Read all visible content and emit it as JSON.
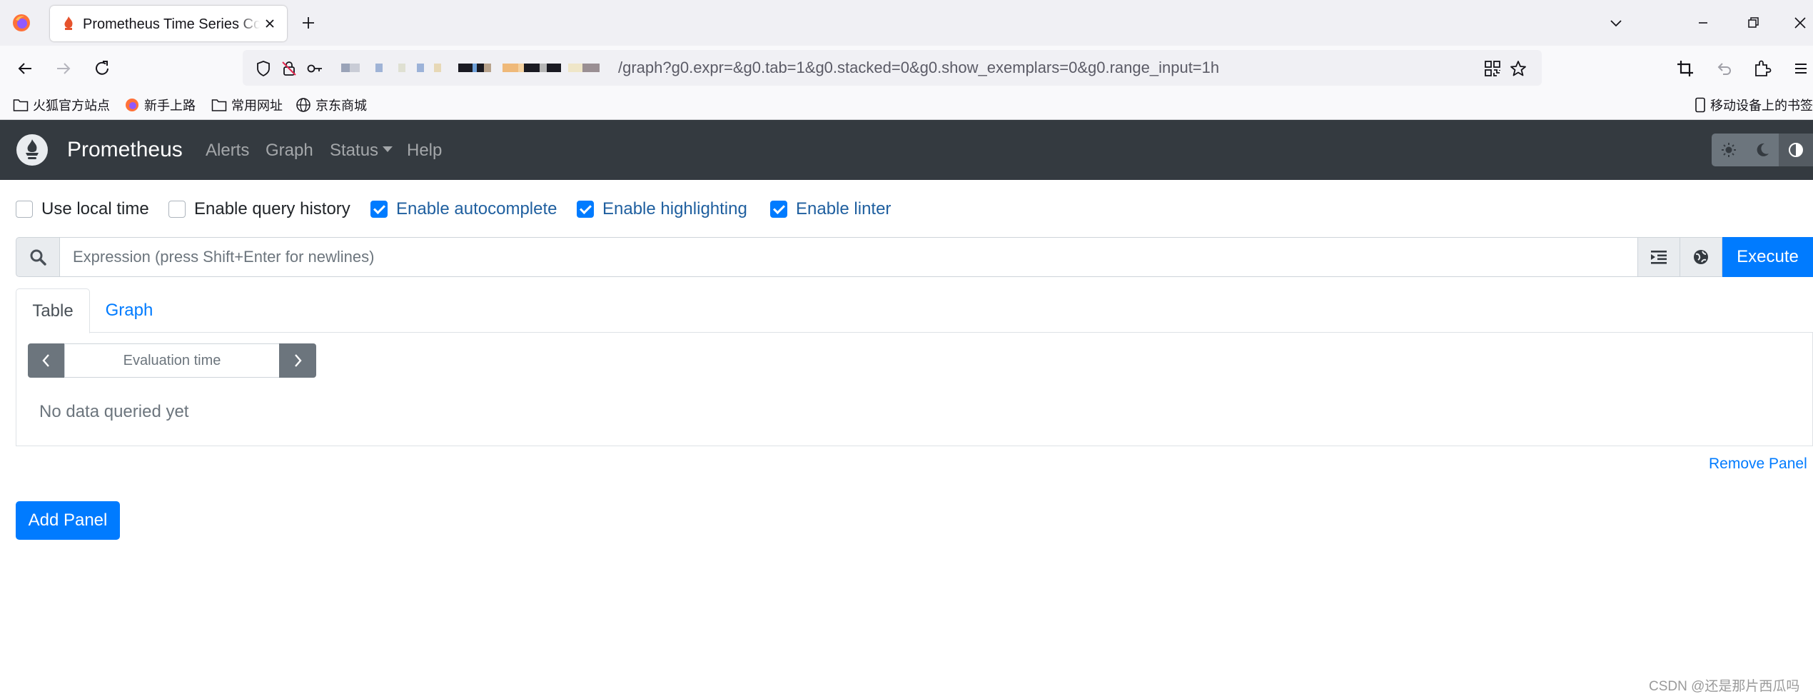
{
  "browser": {
    "tab_title": "Prometheus Time Series Collection and Processing Server",
    "url_visible": "/graph?g0.expr=&g0.tab=1&g0.stacked=0&g0.show_exemplars=0&g0.range_input=1h",
    "bookmarks": [
      "火狐官方站点",
      "新手上路",
      "常用网址",
      "京东商城"
    ],
    "mobile_bookmarks": "移动设备上的书签"
  },
  "app": {
    "brand": "Prometheus",
    "nav": {
      "alerts": "Alerts",
      "graph": "Graph",
      "status": "Status",
      "help": "Help"
    },
    "theme": {
      "selected": "contrast",
      "icons": [
        "sun-icon",
        "moon-icon",
        "contrast-icon"
      ]
    }
  },
  "options": [
    {
      "label": "Use local time",
      "checked": false
    },
    {
      "label": "Enable query history",
      "checked": false
    },
    {
      "label": "Enable autocomplete",
      "checked": true
    },
    {
      "label": "Enable highlighting",
      "checked": true
    },
    {
      "label": "Enable linter",
      "checked": true
    }
  ],
  "expression": {
    "placeholder": "Expression (press Shift+Enter for newlines)",
    "value": "",
    "execute_label": "Execute"
  },
  "panel": {
    "tabs": [
      {
        "label": "Table",
        "active": true
      },
      {
        "label": "Graph",
        "active": false
      }
    ],
    "eval_time_placeholder": "Evaluation time",
    "empty_message": "No data queried yet",
    "remove_label": "Remove Panel"
  },
  "add_panel_label": "Add Panel",
  "watermark": "CSDN @还是那片西瓜吗",
  "colors": {
    "primary": "#007bff",
    "navbar": "#343a40",
    "secondary": "#6c757d"
  }
}
